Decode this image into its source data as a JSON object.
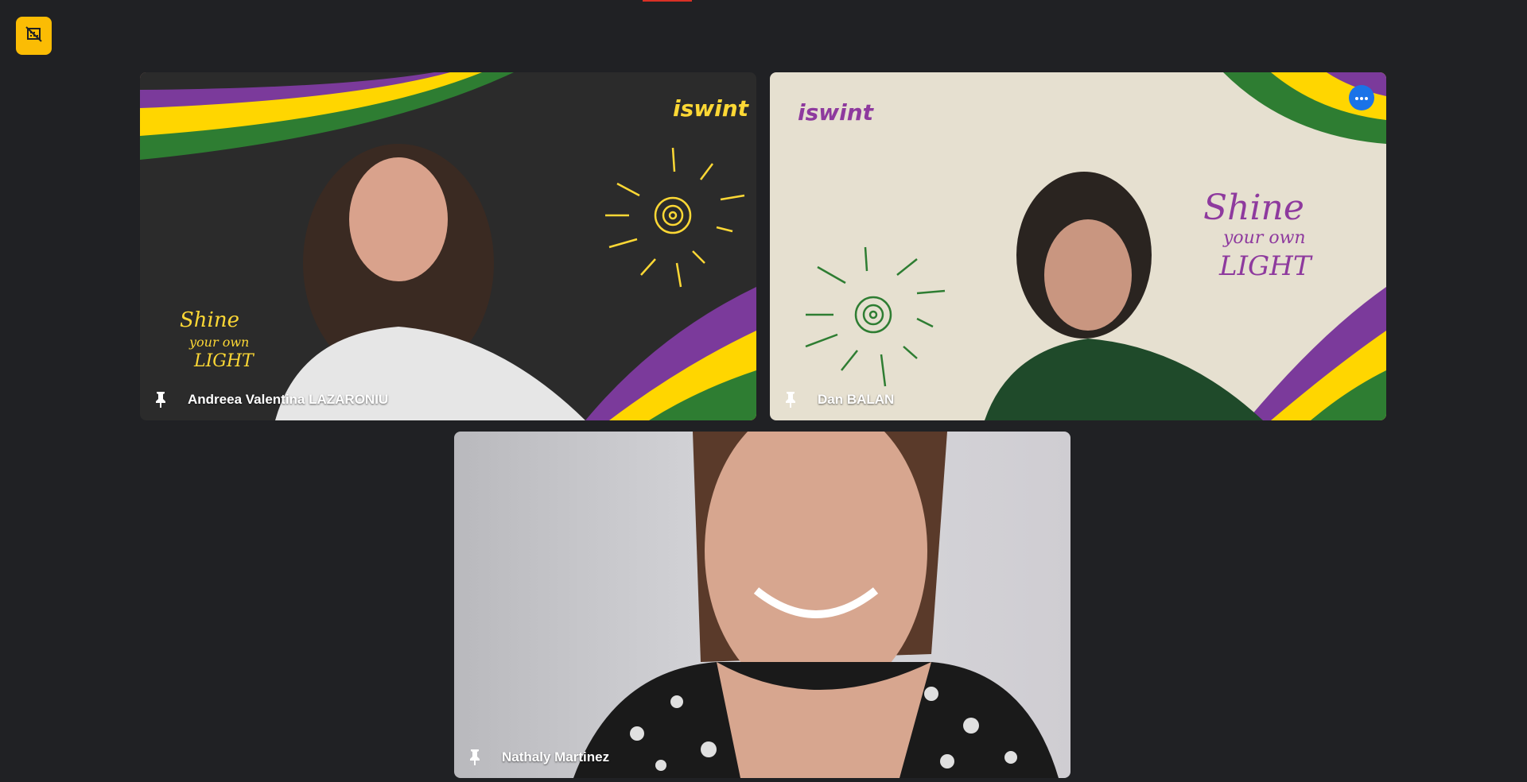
{
  "app": {
    "top_indicator_color": "#d93025"
  },
  "toolbar": {
    "badge_icon": "visual-effects-off-icon",
    "badge_color": "#fbbc04"
  },
  "participants": [
    {
      "name": "Andreea Valentina LAZARONIU",
      "pin_icon": "pin-icon",
      "background": "dark-chalkboard",
      "drawing_color": "#fdd835",
      "logo_text": "iswint",
      "tagline": [
        "Shine",
        "your own",
        "LIGHT"
      ]
    },
    {
      "name": "Dan BALAN",
      "pin_icon": "pin-icon",
      "more_icon": "more-options-icon",
      "background": "paper",
      "drawing_color": "#8e3a9e",
      "logo_text": "iswint",
      "tagline": [
        "Shine",
        "your own",
        "LIGHT"
      ]
    },
    {
      "name": "Nathaly Martinez",
      "pin_icon": "pin-icon",
      "background": "plain-wall"
    }
  ],
  "brand_colors": {
    "purple": "#7b3a9b",
    "yellow": "#ffd600",
    "green": "#2e7d32"
  }
}
